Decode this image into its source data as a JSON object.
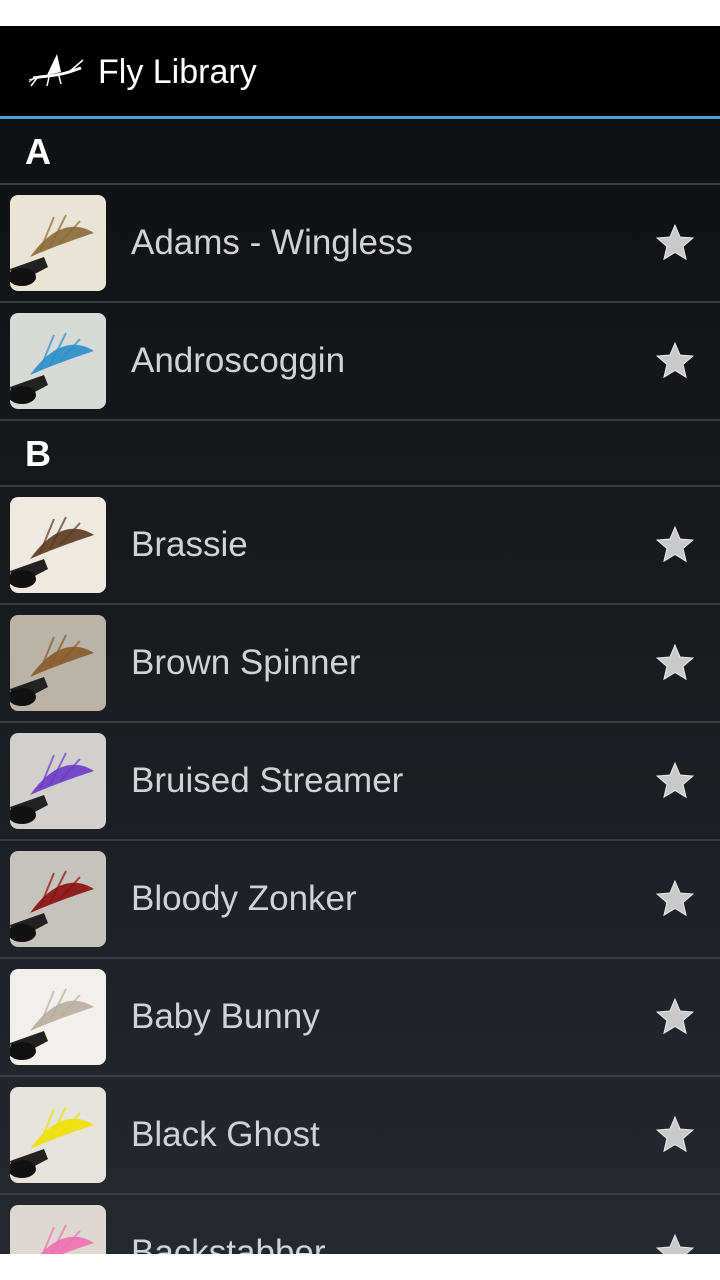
{
  "app": {
    "title": "Fly Library",
    "logo_icon": "mayfly-icon"
  },
  "sections": [
    {
      "letter": "A",
      "items": [
        {
          "name": "Adams - Wingless",
          "thumb": [
            "#e9e4d6",
            "#8a6a3a"
          ]
        },
        {
          "name": "Androscoggin",
          "thumb": [
            "#d8dad8",
            "#2a8fc8"
          ]
        }
      ]
    },
    {
      "letter": "B",
      "items": [
        {
          "name": "Brassie",
          "thumb": [
            "#eeeae2",
            "#5a3a20"
          ]
        },
        {
          "name": "Brown Spinner",
          "thumb": [
            "#b9b3a8",
            "#8a5a2a"
          ]
        },
        {
          "name": "Bruised Streamer",
          "thumb": [
            "#d2d0cc",
            "#6a3ac8"
          ]
        },
        {
          "name": "Bloody Zonker",
          "thumb": [
            "#c6c3bc",
            "#8a1010"
          ]
        },
        {
          "name": "Baby Bunny",
          "thumb": [
            "#f2f0ec",
            "#b8aea0"
          ]
        },
        {
          "name": "Black Ghost",
          "thumb": [
            "#e6e3dc",
            "#f0e000"
          ]
        },
        {
          "name": "Backstabber",
          "thumb": [
            "#ddd8d2",
            "#f070b0"
          ]
        }
      ]
    }
  ],
  "colors": {
    "accent": "#4aa3df",
    "star": "#c9c9c9"
  }
}
